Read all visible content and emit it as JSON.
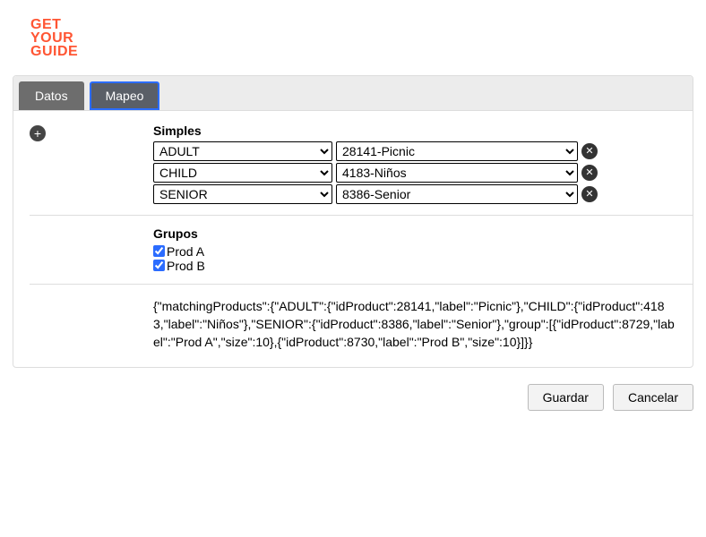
{
  "logo": {
    "line1": "GET",
    "line2": "YOUR",
    "line3": "GUIDE"
  },
  "tabs": {
    "datos": "Datos",
    "mapeo": "Mapeo"
  },
  "addIcon": "+",
  "removeIcon": "✕",
  "sections": {
    "simples": "Simples",
    "grupos": "Grupos"
  },
  "simples": [
    {
      "type": "ADULT",
      "product": "28141-Picnic"
    },
    {
      "type": "CHILD",
      "product": "4183-Niños"
    },
    {
      "type": "SENIOR",
      "product": "8386-Senior"
    }
  ],
  "grupos": [
    {
      "label": "Prod A",
      "checked": true
    },
    {
      "label": "Prod B",
      "checked": true
    }
  ],
  "jsonDump": "{\"matchingProducts\":{\"ADULT\":{\"idProduct\":28141,\"label\":\"Picnic\"},\"CHILD\":{\"idProduct\":4183,\"label\":\"Niños\"},\"SENIOR\":{\"idProduct\":8386,\"label\":\"Senior\"},\"group\":[{\"idProduct\":8729,\"label\":\"Prod A\",\"size\":10},{\"idProduct\":8730,\"label\":\"Prod B\",\"size\":10}]}}",
  "footer": {
    "save": "Guardar",
    "cancel": "Cancelar"
  }
}
